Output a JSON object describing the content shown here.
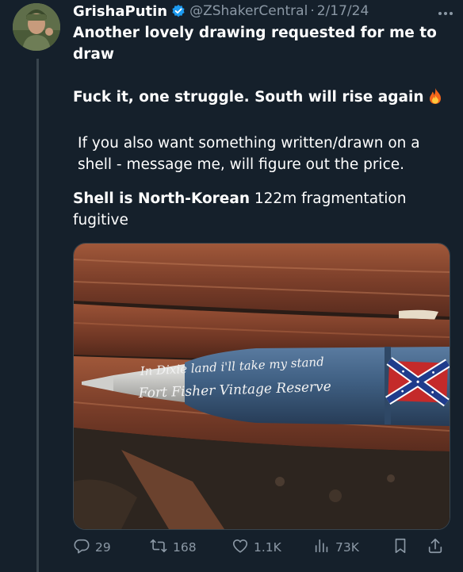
{
  "user": {
    "display_name": "GrishaPutin",
    "handle": "@ZShakerCentral",
    "separator": "·",
    "date": "2/17/24",
    "verified": true
  },
  "tweet": {
    "line1": "Another lovely drawing requested for me to draw",
    "line2": "Fuck it, one struggle. South will rise again",
    "line3": "If you also want something written/drawn on a shell - message me, will figure out the price.",
    "line4_bold": "Shell is North-Korean",
    "line4_rest": " 122m fragmentation fugitive"
  },
  "media": {
    "shell_text_line1": "In Dixie land i'll take my stand",
    "shell_text_line2": "Fort Fisher Vintage Reserve",
    "shell_color": "#3f5f82",
    "flag_red": "#c42a2a",
    "flag_blue": "#1f3c8c"
  },
  "actions": {
    "replies": "29",
    "reposts": "168",
    "likes": "1.1K",
    "views": "73K"
  },
  "icons": {
    "verified": "verified-badge-icon",
    "fire": "fire-emoji-icon",
    "more": "more-dots-icon",
    "reply": "reply-icon",
    "repost": "repost-icon",
    "like": "heart-icon",
    "views": "views-icon",
    "bookmark": "bookmark-icon",
    "share": "share-icon"
  },
  "colors": {
    "background": "#15202b",
    "secondary_text": "#8b98a5",
    "verified_blue": "#1d9bf0"
  }
}
